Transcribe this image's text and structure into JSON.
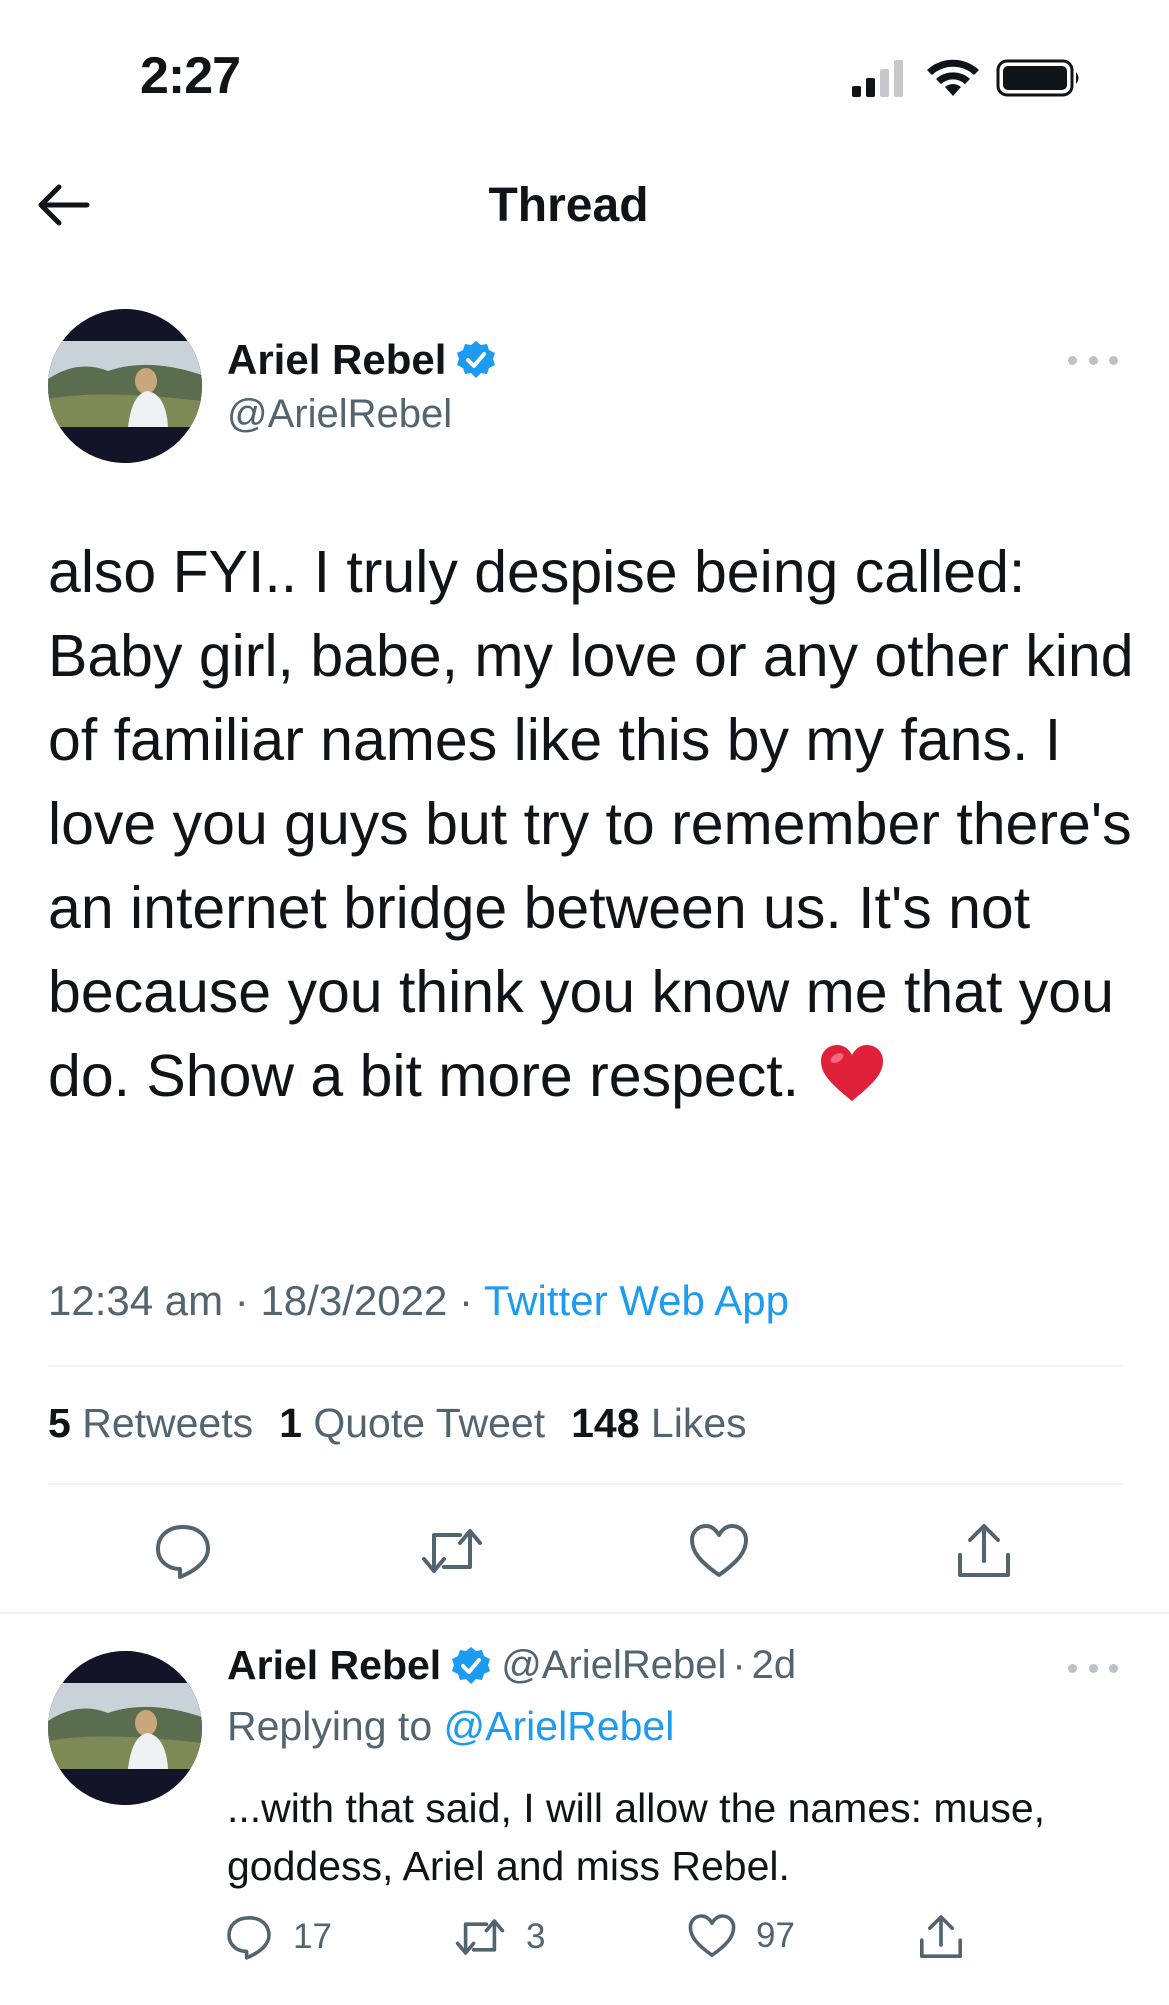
{
  "status_bar": {
    "time": "2:27",
    "icons": [
      "cellular-signal-icon",
      "wifi-icon",
      "battery-icon"
    ]
  },
  "header": {
    "back_icon": "back-arrow-icon",
    "title": "Thread"
  },
  "tweet": {
    "author_name": "Ariel Rebel",
    "author_handle": "@ArielRebel",
    "verified": true,
    "text": "also FYI.. I truly despise being called: Baby girl, babe, my love or any other kind of familiar names like this by my fans. I love you guys but try to remember there's an internet bridge between us. It's not because you think you know me that you do. Show a bit more respect.",
    "emoji": "red-heart-emoji",
    "time": "12:34 am",
    "date": "18/3/2022",
    "source": "Twitter Web App",
    "stats": {
      "retweets_count": "5",
      "retweets_label": "Retweets",
      "quotes_count": "1",
      "quotes_label": "Quote Tweet",
      "likes_count": "148",
      "likes_label": "Likes"
    },
    "actions": [
      "reply-icon",
      "retweet-icon",
      "like-icon",
      "share-icon"
    ]
  },
  "reply": {
    "author_name": "Ariel Rebel",
    "author_handle": "@ArielRebel",
    "age": "2d",
    "replying_prefix": "Replying to",
    "replying_to": "@ArielRebel",
    "text": "...with that said, I will allow the names: muse, goddess, Ariel and miss Rebel.",
    "reply_count": "17",
    "retweet_count": "3",
    "like_count": "97"
  },
  "colors": {
    "accent": "#1d9bf0",
    "secondary_text": "#536471",
    "primary_text": "#0f1419",
    "divider": "#eff3f4",
    "heart": "#e0213a"
  }
}
